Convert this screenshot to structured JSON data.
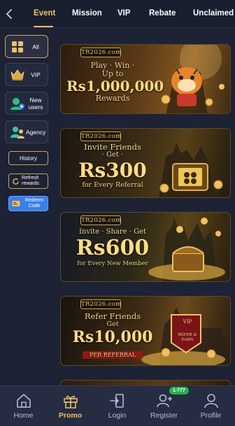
{
  "topbar": {
    "back_icon": "chevron-left-icon",
    "tabs": [
      {
        "label": "Event",
        "active": true
      },
      {
        "label": "Mission",
        "active": false
      },
      {
        "label": "VIP",
        "active": false
      },
      {
        "label": "Rebate",
        "active": false
      },
      {
        "label": "Unclaimed",
        "active": false
      }
    ]
  },
  "sidebar": {
    "items": [
      {
        "label": "All",
        "icon": "grid-icon",
        "active": true
      },
      {
        "label": "VIP",
        "icon": "crown-icon",
        "active": false
      },
      {
        "label": "New users",
        "icon": "new-user-icon",
        "active": false
      },
      {
        "label": "Agency",
        "icon": "agency-icon",
        "active": false
      }
    ],
    "history_label": "History",
    "refresh_label": "Refresh rewards",
    "redeem_label": "Redeem Code"
  },
  "banners": [
    {
      "logo": "TR2026.com",
      "line1": "Play · Win ·",
      "line2": "Up to",
      "big": "Rs1,000,000",
      "line3": "Rewards",
      "ribbon": ""
    },
    {
      "logo": "TR2026.com",
      "line1": "Invite Friends",
      "line2": "· Get ·",
      "big": "Rs300",
      "line3": "for Every Referral",
      "ribbon": ""
    },
    {
      "logo": "TR2026.com",
      "line1": "Invite · Share · Get",
      "line2": "",
      "big": "Rs600",
      "line3": "for Every New Member",
      "ribbon": ""
    },
    {
      "logo": "TR2026.com",
      "line1": "Refer Friends",
      "line2": "Get",
      "big": "Rs10,000",
      "line3": "",
      "ribbon": "PER REFERRAL"
    }
  ],
  "banner4_badge": {
    "top": "VIP",
    "bottom": "REFER & EARN"
  },
  "bottom_nav": {
    "items": [
      {
        "label": "Home",
        "icon": "home-icon",
        "active": false
      },
      {
        "label": "Promo",
        "icon": "gift-icon",
        "active": true
      },
      {
        "label": "Login",
        "icon": "login-icon",
        "active": false
      },
      {
        "label": "Register",
        "icon": "add-user-icon",
        "active": false
      },
      {
        "label": "Profile",
        "icon": "profile-icon",
        "active": false
      }
    ],
    "register_badge": "1-777"
  },
  "colors": {
    "background": "#1d2234",
    "accent_gold": "#f0c062",
    "redeem_blue": "#3b7fe8",
    "badge_green": "#27b04a"
  }
}
